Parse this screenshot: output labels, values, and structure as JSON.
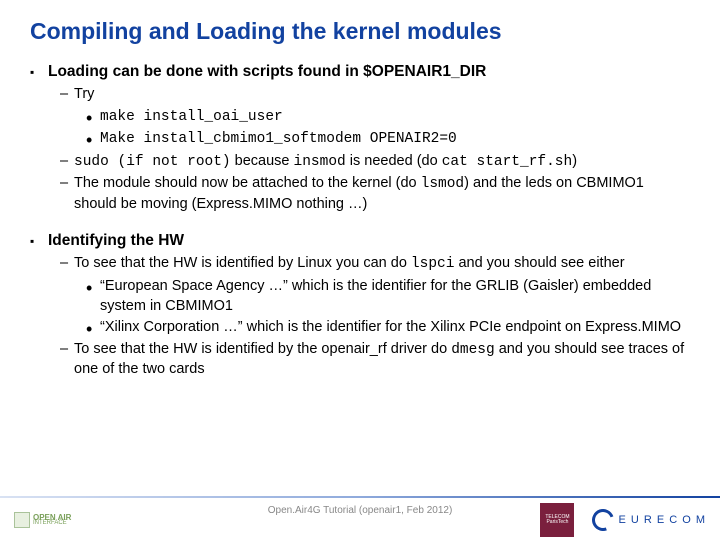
{
  "title": "Compiling and Loading the kernel modules",
  "sec1": {
    "heading": "Loading can be done with scripts found in $OPENAIR1_DIR",
    "try": "Try",
    "cmd1": "make install_oai_user",
    "cmd2": "Make install_cbmimo1_softmodem OPENAIR2=0",
    "sudo_a": "sudo (if not root)",
    "sudo_b": " because ",
    "sudo_c": "insmod",
    "sudo_d": " is needed (do ",
    "sudo_e": "cat start_rf.sh",
    "sudo_f": ")",
    "mod_a": "The module should now be attached to the kernel (do ",
    "mod_b": "lsmod",
    "mod_c": ") and the leds on CBMIMO1 should be moving (Express.MIMO nothing …)"
  },
  "sec2": {
    "heading": "Identifying the HW",
    "see_a": "To see that the HW is identified by Linux you can do ",
    "see_b": "lspci",
    "see_c": " and you should see either",
    "esa": "“European Space Agency …” which is the identifier for the GRLIB (Gaisler) embedded system in CBMIMO1",
    "xil": "“Xilinx Corporation …” which is the identifier for the Xilinx PCIe endpoint on Express.MIMO",
    "drv_a": "To see that the HW is identified by the openair_rf driver do ",
    "drv_b": "dmesg",
    "drv_c": " and you should see traces of one of the two cards"
  },
  "footer": {
    "center": "Open.Air4G Tutorial (openair1, Feb 2012)",
    "openair1": "OPEN AIR",
    "openair2": "INTERFACE",
    "telecom1": "TELECOM",
    "telecom2": "ParisTech",
    "eurecom": "E U R E C O M"
  }
}
